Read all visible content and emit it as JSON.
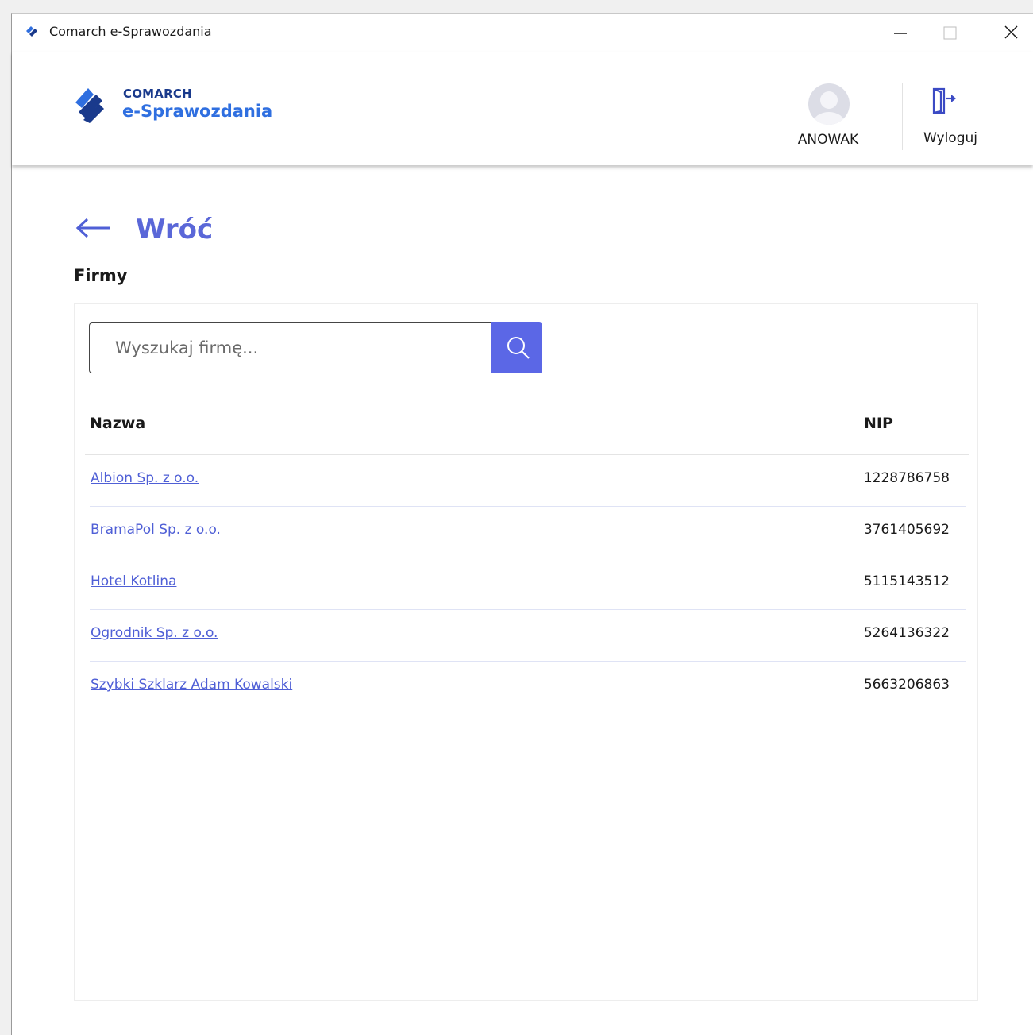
{
  "window": {
    "title": "Comarch e-Sprawozdania",
    "icon": "comarch-logo-icon",
    "controls": [
      "minimize-icon",
      "maximize-icon",
      "close-icon"
    ]
  },
  "header": {
    "logo_line1": "COMARCH",
    "logo_line2": "e-Sprawozdania",
    "user": {
      "name": "ANOWAK",
      "icon": "avatar-icon"
    },
    "logout": {
      "label": "Wyloguj",
      "icon": "logout-door-icon"
    }
  },
  "content": {
    "back_label": "Wróć",
    "section_title": "Firmy",
    "search": {
      "placeholder": "Wyszukaj firmę...",
      "value": "",
      "icon": "search-icon"
    },
    "table": {
      "columns": [
        "Nazwa",
        "NIP"
      ],
      "rows": [
        {
          "name": "Albion Sp. z o.o.",
          "nip": "1228786758"
        },
        {
          "name": "BramaPol Sp. z o.o.",
          "nip": "3761405692"
        },
        {
          "name": "Hotel Kotlina",
          "nip": "5115143512"
        },
        {
          "name": "Ogrodnik Sp. z o.o.",
          "nip": "5264136322"
        },
        {
          "name": "Szybki Szklarz Adam Kowalski",
          "nip": "5663206863"
        }
      ]
    }
  },
  "colors": {
    "accent": "#5b67e6",
    "link": "#4f5fd6",
    "logo_dark": "#1a3a8c",
    "logo_light": "#2f6fe0"
  }
}
